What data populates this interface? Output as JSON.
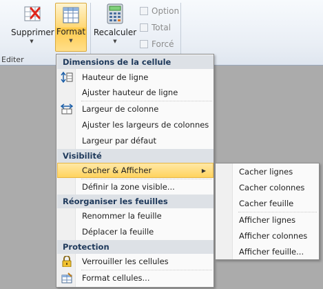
{
  "ribbon": {
    "delete_label": "Supprimer",
    "format_label": "Format",
    "recalc_label": "Recalculer",
    "group_edit_label": "Editer",
    "checkboxes": [
      {
        "label": "Option",
        "checked": false
      },
      {
        "label": "Total",
        "checked": false
      },
      {
        "label": "Forcé",
        "checked": false
      }
    ]
  },
  "menu": {
    "sections": [
      {
        "header": "Dimensions de la cellule"
      },
      {
        "header": "Visibilité"
      },
      {
        "header": "Réorganiser les feuilles"
      },
      {
        "header": "Protection"
      }
    ],
    "items": {
      "row_height": "Hauteur de ligne",
      "fit_row_height": "Ajuster hauteur de ligne",
      "col_width": "Largeur de colonne",
      "fit_col_widths": "Ajuster les largeurs de colonnes",
      "default_width": "Largeur par défaut",
      "hide_show": "Cacher & Afficher",
      "visible_zone": "Définir la zone visible...",
      "rename_sheet": "Renommer la feuille",
      "move_sheet": "Déplacer la feuille",
      "lock_cells": "Verrouiller les cellules",
      "format_cells": "Format cellules..."
    }
  },
  "submenu": {
    "items": [
      "Cacher lignes",
      "Cacher colonnes",
      "Cacher feuille",
      "Afficher lignes",
      "Afficher colonnes",
      "Afficher feuille..."
    ]
  },
  "colors": {
    "highlight": "#ffd35e",
    "section_header_bg": "#dde1e6",
    "section_header_text": "#1e395b",
    "workspace": "#ababab"
  }
}
